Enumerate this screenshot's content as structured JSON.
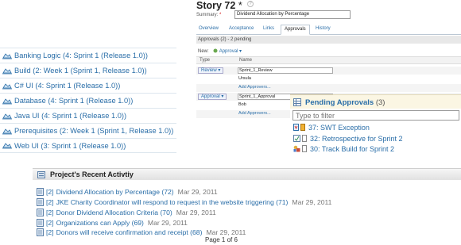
{
  "projects": [
    {
      "label": "Banking Logic  (4: Sprint 1 (Release 1.0))"
    },
    {
      "label": "Build  (2: Week 1 (Sprint 1, Release 1.0))"
    },
    {
      "label": "C# UI  (4: Sprint 1 (Release 1.0))"
    },
    {
      "label": "Database  (4: Sprint 1 (Release 1.0))"
    },
    {
      "label": "Java UI  (4: Sprint 1 (Release 1.0))"
    },
    {
      "label": "Prerequisites  (2: Week 1 (Sprint 1, Release 1.0))"
    },
    {
      "label": "Web UI  (3: Sprint 1 (Release 1.0))"
    }
  ],
  "story": {
    "title": "Story 72",
    "dirty_marker": " *",
    "summary_label": "Summary:",
    "required_marker": "*",
    "summary_value": "Dividend Allocation by Percentage",
    "tabs": [
      {
        "label": "Overview"
      },
      {
        "label": "Acceptance"
      },
      {
        "label": "Links"
      },
      {
        "label": "Approvals"
      },
      {
        "label": "History"
      }
    ],
    "approvals_bar": "Approvals (2) - 2 pending",
    "new_label": "New:",
    "new_link": "Approval",
    "columns": {
      "type": "Type",
      "name": "Name"
    },
    "groups": [
      {
        "type_label": "Review",
        "name_value": "Sprint_1_Review",
        "approver": "Ursula",
        "add_link": "Add Approvers..."
      },
      {
        "type_label": "Approval",
        "name_value": "Sprint_1_Approval",
        "approver": "Bob",
        "add_link": "Add Approvers..."
      }
    ]
  },
  "pending": {
    "title": "Pending Approvals",
    "count": "(3)",
    "filter_placeholder": "Type to filter",
    "items": [
      {
        "label": "37: SWT Exception"
      },
      {
        "label": "32: Retrospective for Sprint 2"
      },
      {
        "label": "30: Track Build for Sprint 2"
      }
    ]
  },
  "activity": {
    "title": "Project's Recent Activtiy",
    "items": [
      {
        "prefix": "[2]",
        "link": "Dividend Allocation by Percentage (72)",
        "date": "Mar 29, 2011"
      },
      {
        "prefix": "[2]",
        "link": "JKE Charity Coordinator will respond to request in the website triggering (71)",
        "date": "Mar 29, 2011"
      },
      {
        "prefix": "[2]",
        "link": "Donor Dividend Allocation Criteria (70)",
        "date": "Mar 29, 2011"
      },
      {
        "prefix": "[2]",
        "link": "Organizations can Apply (69)",
        "date": "Mar 29, 2011"
      },
      {
        "prefix": "[2]",
        "link": "Donors will receive confirmation and receipt (68)",
        "date": "Mar 29, 2011"
      }
    ],
    "pager": "Page 1 of 6"
  },
  "colors": {
    "link": "#2a6ea8",
    "header_tint": "#fbf6e3"
  }
}
